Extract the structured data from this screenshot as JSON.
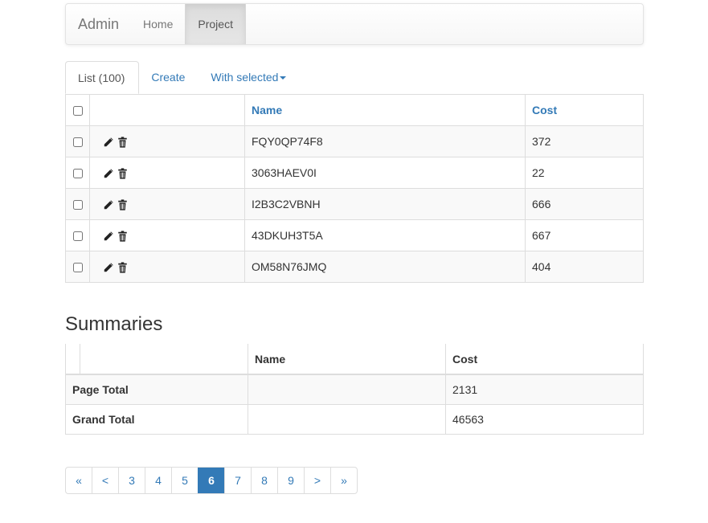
{
  "navbar": {
    "brand": "Admin",
    "links": [
      {
        "label": "Home",
        "active": false
      },
      {
        "label": "Project",
        "active": true
      }
    ]
  },
  "tabs": {
    "list": "List (100)",
    "create": "Create",
    "with_selected": "With selected"
  },
  "table": {
    "headers": {
      "name": "Name",
      "cost": "Cost"
    },
    "rows": [
      {
        "name": "FQY0QP74F8",
        "cost": "372"
      },
      {
        "name": "3063HAEV0I",
        "cost": "22"
      },
      {
        "name": "I2B3C2VBNH",
        "cost": "666"
      },
      {
        "name": "43DKUH3T5A",
        "cost": "667"
      },
      {
        "name": "OM58N76JMQ",
        "cost": "404"
      }
    ]
  },
  "summaries": {
    "title": "Summaries",
    "headers": {
      "name": "Name",
      "cost": "Cost"
    },
    "rows": [
      {
        "label": "Page Total",
        "name": "",
        "cost": "2131"
      },
      {
        "label": "Grand Total",
        "name": "",
        "cost": "46563"
      }
    ]
  },
  "pagination": {
    "first": "«",
    "prev": "<",
    "pages": [
      "3",
      "4",
      "5",
      "6",
      "7",
      "8",
      "9"
    ],
    "current": "6",
    "next": ">",
    "last": "»"
  },
  "icons": {
    "edit": "pencil-icon",
    "delete": "trash-icon"
  },
  "colors": {
    "link": "#337ab7",
    "active_page": "#337ab7",
    "border": "#dddddd"
  }
}
